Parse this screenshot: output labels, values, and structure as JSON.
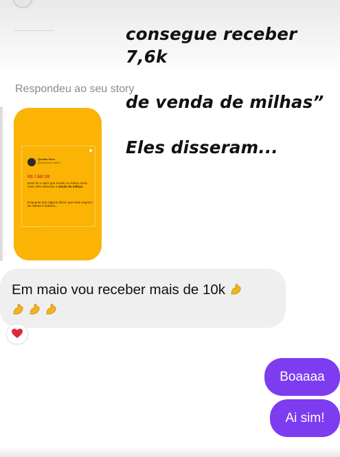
{
  "caption": {
    "line1": "consegue receber 7,6k",
    "line2": "de venda de milhas”",
    "line3": "Eles disseram..."
  },
  "story_reply": {
    "label": "Respondeu ao seu story",
    "post": {
      "name": "Queilao Nero",
      "handle": "@queilaonero.milhas",
      "amount": "R$ 7.667,00",
      "text1": "Esse foi o valor que recebi na minha conta esse mês referente a",
      "text1_bold": "venda de milhas.",
      "text2": "Enquanto isso alguns dizem que esse negócio de milhas é bobeira..."
    },
    "card_color": "#fbb305"
  },
  "incoming_message": {
    "text": "Em maio vou receber mais de 10k",
    "reaction": "heart",
    "emoji": "flexed-biceps",
    "emoji_color": "#f2b51c"
  },
  "outgoing_messages": [
    {
      "text": "Boaaaa"
    },
    {
      "text": "Ai sim!"
    }
  ],
  "colors": {
    "outgoing_bubble": "#7d3cf0",
    "incoming_bubble": "#efefef",
    "heart": "#e0283e"
  }
}
